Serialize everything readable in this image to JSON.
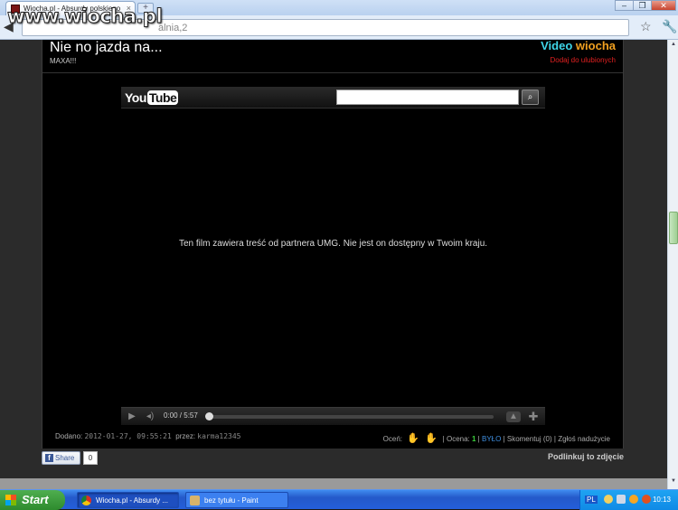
{
  "browser": {
    "tab_title": "Wiocha.pl - Absurdy polskiego",
    "tab_close": "×",
    "new_tab": "+",
    "url_visible": "alnia,2",
    "watermark": "www.wiocha.pl",
    "window_controls": [
      "–",
      "❐",
      "✕"
    ]
  },
  "page": {
    "title": "Nie no jazda na...",
    "subtitle": "MAXA!!!",
    "video_label_a": "Video",
    "video_label_b": "wiocha",
    "add_favorites": "Dodaj do ulubionych"
  },
  "player": {
    "logo_you": "You",
    "logo_tube": "Tube",
    "message": "Ten film zawiera treść od partnera UMG. Nie jest on dostępny w Twoim kraju.",
    "time": "0:00 / 5:57",
    "progress_fraction": 0
  },
  "footer": {
    "added_label": "Dodano:",
    "added_value": "2012-01-27, 09:55:21",
    "by_label": "przez:",
    "by_value": "karma12345",
    "rate_label": "Oceń:",
    "score_label": "Ocena:",
    "score_value": "1",
    "bylo": "BYŁO",
    "comment": "Skomentuj (0)",
    "report": "Zgłoś nadużycie"
  },
  "share": {
    "label": "Share",
    "count": "0",
    "link_photo": "Podlinkuj to zdjęcie"
  },
  "taskbar": {
    "start": "Start",
    "item1": "Wiocha.pl - Absurdy ...",
    "item2": "bez tytułu - Paint",
    "lang": "PL",
    "clock": "10:13"
  }
}
